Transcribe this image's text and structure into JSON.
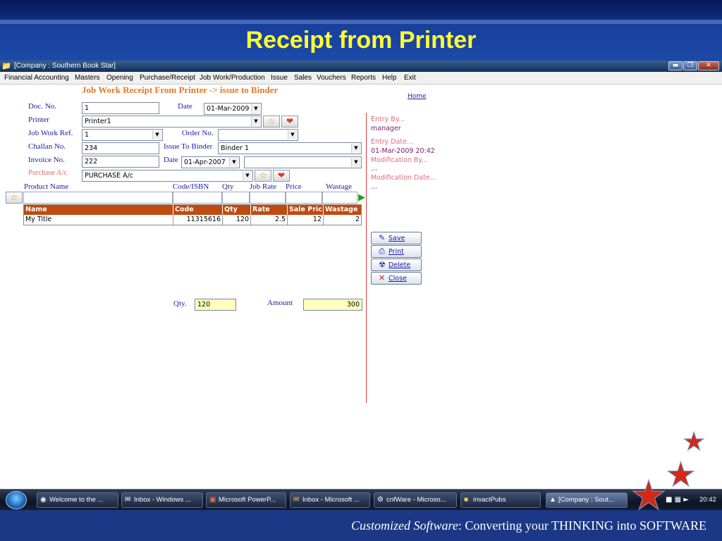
{
  "slide": {
    "title": "Receipt from Printer",
    "footer_italic": "Customized Software",
    "footer_rest": ":   Converting your THINKING into SOFTWARE"
  },
  "window": {
    "title": "[Company : Southern Book Star]",
    "controls": [
      "▬",
      "❐",
      "✕"
    ]
  },
  "menu": [
    "Financial Accounting",
    "Masters",
    "Opening",
    "Purchase/Receipt",
    "Job Work/Production",
    "Issue",
    "Sales",
    "Vouchers",
    "Reports",
    "Help",
    "Exit"
  ],
  "form": {
    "heading": "Job Work Receipt From Printer  -> issue to Binder",
    "home_link": "Home",
    "doc_no": {
      "label": "Doc. No.",
      "value": "1"
    },
    "date": {
      "label": "Date",
      "value": "01-Mar-2009"
    },
    "printer": {
      "label": "Printer",
      "value": "Printer1"
    },
    "job_work_ref": {
      "label": "Job Work Ref.",
      "value": "1"
    },
    "order_no": {
      "label": "Order No.",
      "value": ""
    },
    "challan_no": {
      "label": "Challan No.",
      "value": "234"
    },
    "issue_to_binder": {
      "label": "Issue To Binder",
      "value": "Binder 1"
    },
    "invoice_no": {
      "label": "Invoice No.",
      "value": "222"
    },
    "invoice_date": {
      "label": "Date",
      "value": "01-Apr-2007"
    },
    "invoice_extra": {
      "value": ""
    },
    "purchase_ac": {
      "label": "Purchase A/c",
      "value": "PURCHASE  A/c"
    },
    "entry_columns": [
      "Product Name",
      "Code/ISBN",
      "Qty",
      "Job Rate",
      "Price",
      "Wastage"
    ],
    "grid": {
      "headers": [
        "Name",
        "Code",
        "Qty",
        "Rate",
        "Sale Pric",
        "Wastage"
      ],
      "rows": [
        [
          "My Title",
          "11315616",
          "120",
          "2.5",
          "12",
          "2"
        ]
      ]
    },
    "qty": {
      "label": "Qty.",
      "value": "120"
    },
    "amount": {
      "label": "Amount",
      "value": "300"
    }
  },
  "audit": {
    "entry_by_label": "Entry  By...",
    "entry_by_value": "manager",
    "entry_date_label": "Entry  Date...",
    "entry_date_value": "01-Mar-2009 20:42",
    "mod_by_label": "Modification  By...",
    "mod_by_value": "...",
    "mod_date_label": "Modification  Date...",
    "mod_date_value": "..."
  },
  "actions": {
    "save": "Save",
    "print": "Print",
    "delete": "Delete",
    "close": "Close"
  },
  "taskbar": {
    "items": [
      "Welcome to the ...",
      "Inbox - Windows ...",
      "Microsoft PowerP...",
      "Inbox - Microsoft ...",
      "cnfWare - Microso...",
      "invactPubs",
      "[Company : Sout..."
    ],
    "clock": "20:42"
  },
  "colors": {
    "title_yellow": "#ffff33",
    "grid_header": "#c04a10",
    "label_blue": "#1c1ca8",
    "heading_orange": "#e0792a",
    "star_red": "#d02a16"
  }
}
